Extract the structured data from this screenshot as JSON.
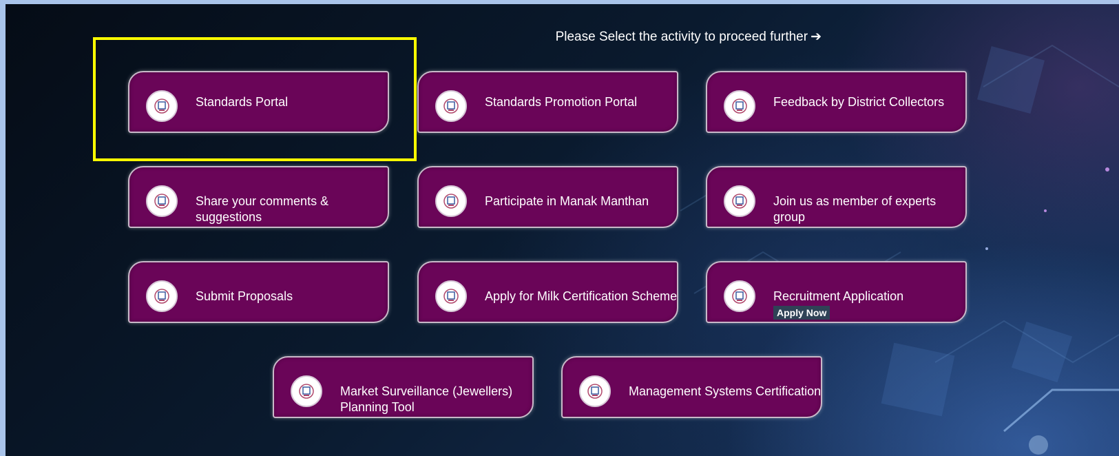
{
  "prompt": {
    "text": "Please Select the activity to proceed further",
    "arrow_icon": "arrow-right-icon"
  },
  "logo_icon": "bis-emblem-icon",
  "cards": [
    {
      "label": "Standards Portal"
    },
    {
      "label": "Standards Promotion Portal"
    },
    {
      "label": "Feedback by District Collectors"
    },
    {
      "label": "Share your comments & suggestions"
    },
    {
      "label": "Participate in Manak Manthan"
    },
    {
      "label": "Join us as member of experts group"
    },
    {
      "label": "Submit Proposals"
    },
    {
      "label": "Apply for Milk Certification Scheme"
    },
    {
      "label": "Recruitment Application",
      "badge": "Apply Now"
    },
    {
      "label": "Market Surveillance (Jewellers) Planning Tool"
    },
    {
      "label": "Management Systems Certification"
    }
  ],
  "colors": {
    "card_fill": "#6a0558",
    "card_border": "#c9b9c9",
    "highlight": "#ffff00",
    "background_dark": "#050c16"
  },
  "highlighted_card": "Standards Portal"
}
